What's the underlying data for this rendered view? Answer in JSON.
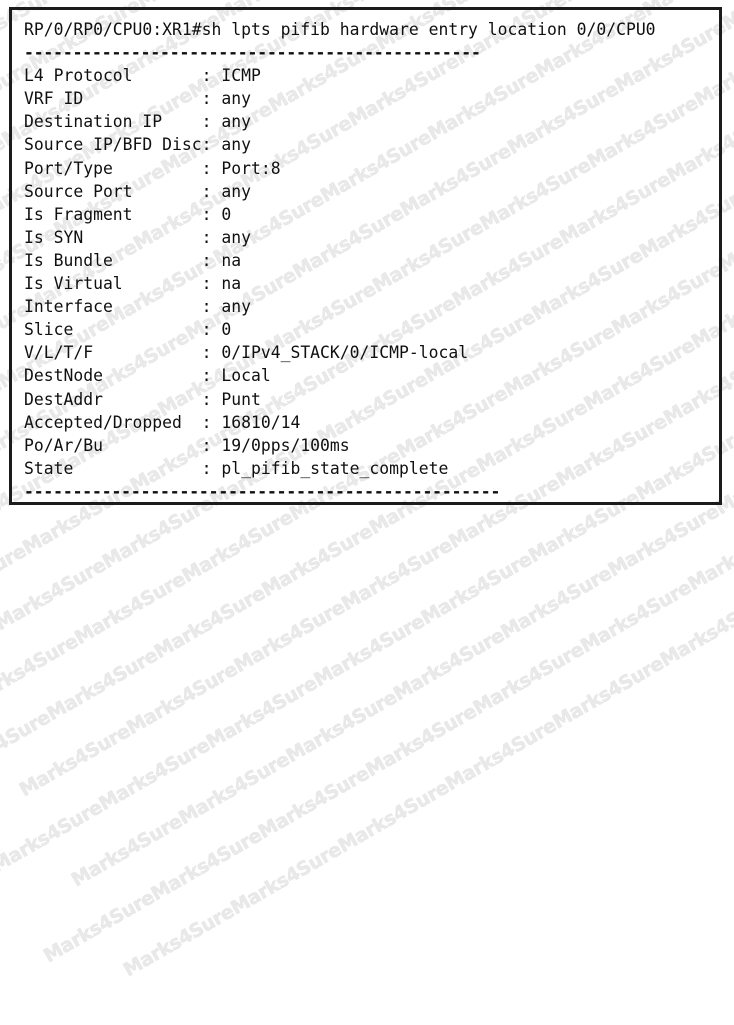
{
  "terminal": {
    "prompt": "RP/0/RP0/CPU0:XR1#",
    "command": "sh lpts pifib hardware entry location 0/0/CPU0",
    "prompt_line": "RP/0/RP0/CPU0:XR1#sh lpts pifib hardware entry location 0/0/CPU0",
    "separator_top": "-----------------------------------------------",
    "separator_bottom": "-------------------------------------------------",
    "colon": ":",
    "label_column_width": 18,
    "fields": [
      {
        "label": "L4 Protocol",
        "value": "ICMP"
      },
      {
        "label": "VRF ID",
        "value": "any"
      },
      {
        "label": "Destination IP",
        "value": "any"
      },
      {
        "label": "Source IP/BFD Disc",
        "value": "any"
      },
      {
        "label": "Port/Type",
        "value": "Port:8"
      },
      {
        "label": "Source Port",
        "value": "any"
      },
      {
        "label": "Is Fragment",
        "value": "0"
      },
      {
        "label": "Is SYN",
        "value": "any"
      },
      {
        "label": "Is Bundle",
        "value": "na"
      },
      {
        "label": "Is Virtual",
        "value": "na"
      },
      {
        "label": "Interface",
        "value": "any"
      },
      {
        "label": "Slice",
        "value": "0"
      },
      {
        "label": "V/L/T/F",
        "value": "0/IPv4_STACK/0/ICMP-local"
      },
      {
        "label": "DestNode",
        "value": "Local"
      },
      {
        "label": "DestAddr",
        "value": "Punt"
      },
      {
        "label": "Accepted/Dropped",
        "value": "16810/14"
      },
      {
        "label": "Po/Ar/Bu",
        "value": "19/0pps/100ms"
      },
      {
        "label": "State",
        "value": "pl_pifib_state_complete"
      }
    ]
  },
  "watermark": {
    "text": "Marks4Sure",
    "color": "#e9e9e9",
    "rows": 20,
    "per_row": 10
  },
  "colors": {
    "background": "#ffffff",
    "text": "#101010",
    "border": "#1b1b1b",
    "watermark": "#e9e9e9"
  }
}
